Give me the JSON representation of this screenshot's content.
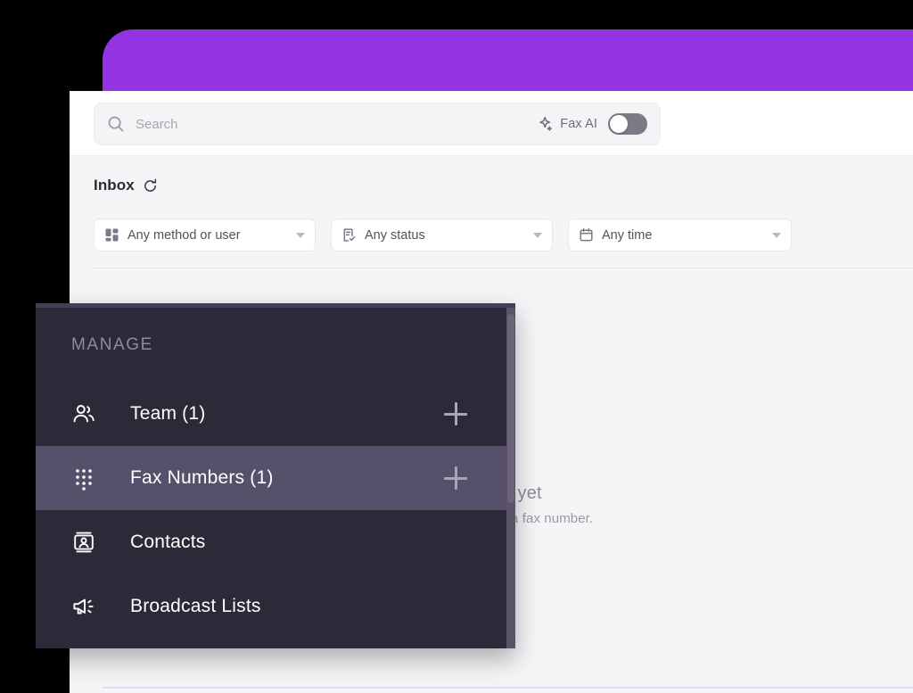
{
  "theme": {
    "brand_purple": "#9333e3",
    "sidebar_bg": "#2c2a38",
    "sidebar_active_bg": "#56506a",
    "panel_bg": "#f5f5f7",
    "accent_line": "#e6d8f5"
  },
  "topbar": {
    "name": "purple-brand-bar"
  },
  "search": {
    "placeholder": "Search",
    "value": "",
    "icon": "search-icon"
  },
  "fax_ai": {
    "label": "Fax AI",
    "icon": "sparkle-icon",
    "toggle_state": "off"
  },
  "inbox": {
    "title": "Inbox",
    "refresh_icon": "refresh-icon"
  },
  "filters": [
    {
      "label": "Any method or user",
      "icon": "dashboard-grid-icon",
      "caret": "chevron-down-icon"
    },
    {
      "label": "Any status",
      "icon": "document-check-icon",
      "caret": "chevron-down-icon"
    },
    {
      "label": "Any time",
      "icon": "calendar-icon",
      "caret": "chevron-down-icon"
    }
  ],
  "empty_state": {
    "title": "No faxes yet",
    "subtitle": "Send a fax or setup a fax number."
  },
  "sidebar": {
    "section_title": "MANAGE",
    "items": [
      {
        "label": "Team (1)",
        "icon": "people-icon",
        "action": "add-team-member",
        "active": false,
        "has_add": true
      },
      {
        "label": "Fax Numbers (1)",
        "icon": "dialpad-icon",
        "action": "add-fax-number",
        "active": true,
        "has_add": true
      },
      {
        "label": "Contacts",
        "icon": "contact-card-icon",
        "action": "",
        "active": false,
        "has_add": false
      },
      {
        "label": "Broadcast Lists",
        "icon": "megaphone-icon",
        "action": "",
        "active": false,
        "has_add": false
      }
    ]
  }
}
